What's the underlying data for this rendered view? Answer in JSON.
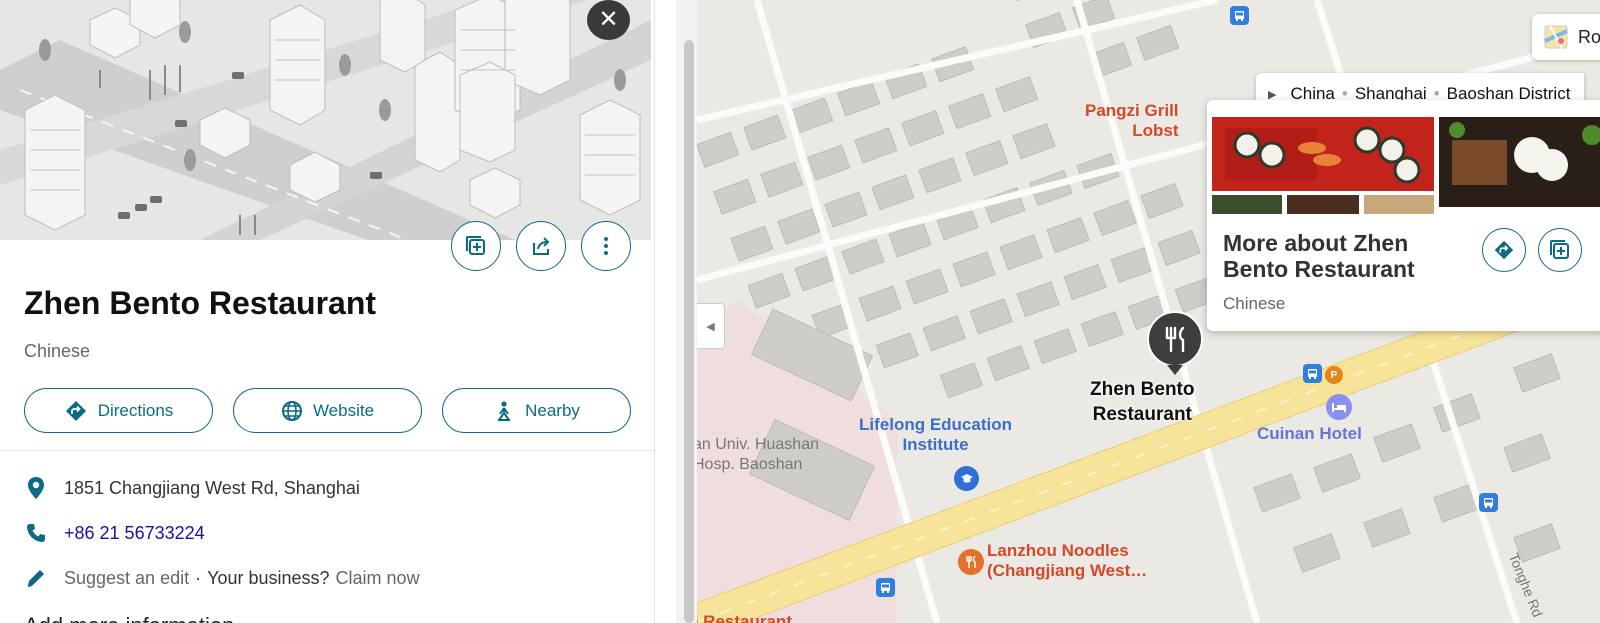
{
  "place": {
    "name": "Zhen Bento Restaurant",
    "category": "Chinese"
  },
  "actions": {
    "directions_label": "Directions",
    "website_label": "Website",
    "nearby_label": "Nearby"
  },
  "details": {
    "address": "1851 Changjiang West Rd, Shanghai",
    "phone": "+86 21 56733224",
    "suggest_edit": "Suggest an edit",
    "separator": "·",
    "your_business": "Your business?",
    "claim_now": "Claim now",
    "add_more_info": "Add more information"
  },
  "map": {
    "breadcrumb": [
      "China",
      "Shanghai",
      "Baoshan District"
    ],
    "road_chip_label": "Ro",
    "labels": {
      "pangzi": "Pangzi Grill\nLobst",
      "lifelong": "Lifelong Education\nInstitute",
      "hospital": "an Univ. Huashan\nHosp. Baoshan",
      "zhen_pin": "Zhen Bento\nRestaurant",
      "cuinan": "Cuinan Hotel",
      "lanzhou": "Lanzhou Noodles\n(Changjiang West…",
      "restaurant_bottom": "e Restaurant",
      "tonghe": "Tonghe Rd"
    },
    "parking_glyph": "P"
  },
  "card": {
    "title": "More about Zhen Bento Restaurant",
    "category": "Chinese"
  },
  "colors": {
    "accent": "#0b6b87",
    "link": "#1a0dab",
    "map_orange": "#d4472b",
    "map_blue": "#3b6fc8",
    "map_purple": "#6a72d8",
    "pin": "#3d3d3d"
  }
}
